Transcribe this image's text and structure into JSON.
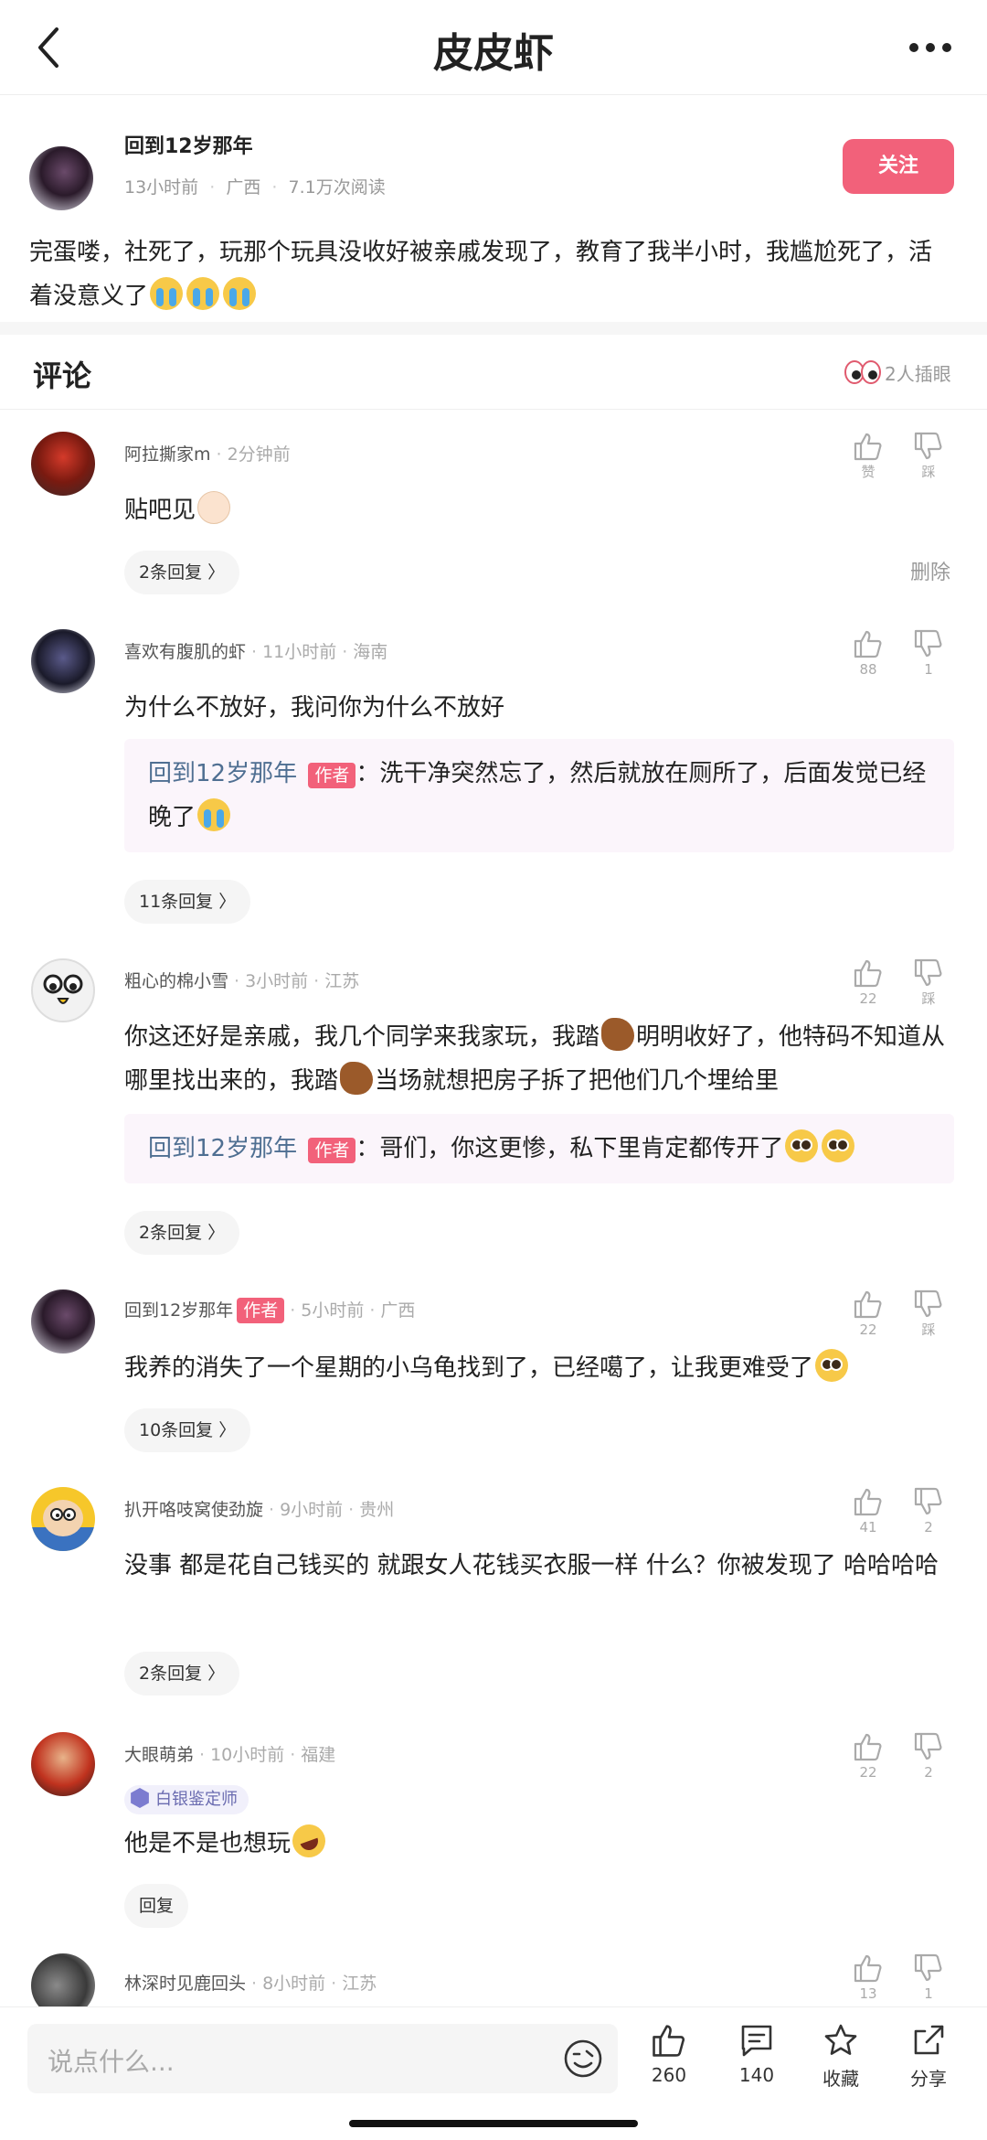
{
  "nav": {
    "title": "皮皮虾"
  },
  "post": {
    "author": "回到12岁那年",
    "time": "13小时前",
    "location": "广西",
    "views": "7.1万次阅读",
    "follow_label": "关注",
    "content": "完蛋喽，社死了，玩那个玩具没收好被亲戚发现了，教育了我半小时，我尴尬死了，活着没意义了"
  },
  "comments_header": {
    "label": "评论",
    "peek": "2人插眼"
  },
  "comments": [
    {
      "name": "阿拉撕家m",
      "time": "2分钟前",
      "text": "贴吧见",
      "up_label": "赞",
      "down_label": "踩",
      "replies": "2条回复 〉",
      "delete": "删除"
    },
    {
      "name": "喜欢有腹肌的虾",
      "time": "11小时前",
      "location": "海南",
      "text": "为什么不放好，我问你为什么不放好",
      "up_count": "88",
      "down_count": "1",
      "reply_author": "回到12岁那年",
      "author_tag": "作者",
      "reply_text": "：洗干净突然忘了，然后就放在厕所了，后面发觉已经晚了",
      "replies": "11条回复 〉"
    },
    {
      "name": "粗心的棉小雪",
      "time": "3小时前",
      "location": "江苏",
      "text_a": "你这还好是亲戚，我几个同学来我家玩，我踏",
      "text_b": "明明收好了，他特码不知道从哪里找出来的，我踏",
      "text_c": "当场就想把房子拆了把他们几个埋给里",
      "up_count": "22",
      "down_label": "踩",
      "reply_author": "回到12岁那年",
      "author_tag": "作者",
      "reply_text": "：哥们，你这更惨，私下里肯定都传开了",
      "replies": "2条回复 〉"
    },
    {
      "name": "回到12岁那年",
      "author_tag": "作者",
      "time": "5小时前",
      "location": "广西",
      "text": "我养的消失了一个星期的小乌龟找到了，已经噶了，让我更难受了",
      "up_count": "22",
      "down_label": "踩",
      "replies": "10条回复 〉"
    },
    {
      "name": "扒开咯吱窝使劲旋",
      "time": "9小时前",
      "location": "贵州",
      "text": "没事 都是花自己钱买的 就跟女人花钱买衣服一样 什么？你被发现了 哈哈哈哈",
      "up_count": "41",
      "down_count": "2",
      "replies": "2条回复 〉"
    },
    {
      "name": "大眼萌弟",
      "time": "10小时前",
      "location": "福建",
      "badge": "白银鉴定师",
      "text": "他是不是也想玩",
      "up_count": "22",
      "down_count": "2",
      "replies": "回复"
    },
    {
      "name": "林深时见鹿回头",
      "time": "8小时前",
      "location": "江苏",
      "up_count": "13",
      "down_count": "1"
    }
  ],
  "bottom_bar": {
    "placeholder": "说点什么...",
    "like_count": "260",
    "comment_count": "140",
    "favorite_label": "收藏",
    "share_label": "分享"
  }
}
